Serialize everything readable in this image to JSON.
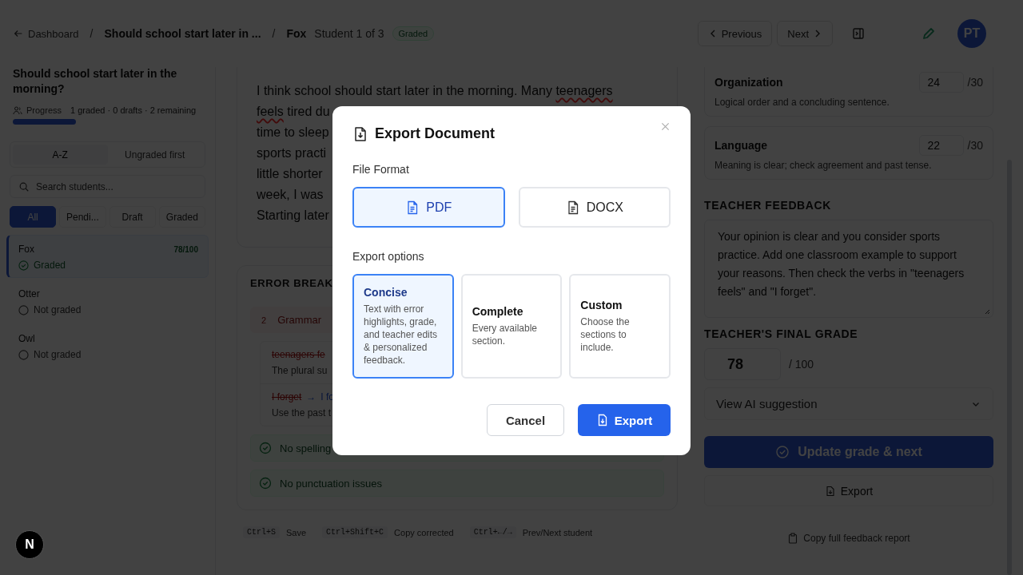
{
  "header": {
    "back_link": "Dashboard",
    "assignment_title": "Should school start later in ...",
    "student_name": "Fox",
    "student_position": "Student 1 of 3",
    "status_badge": "Graded",
    "separators": [
      "/",
      "/"
    ],
    "previous_button": "Previous",
    "next_button": "Next",
    "avatar_initials": "PT"
  },
  "sidebar": {
    "title": "Should school start later in the morning?",
    "progress_label": "Progress",
    "progress_summary": "1 graded · 0 drafts · 2 remaining",
    "progress": {
      "level": 0.33
    },
    "sort_options": [
      {
        "label": "A-Z",
        "selected": true
      },
      {
        "label": "Ungraded first",
        "selected": false
      }
    ],
    "search": {
      "placeholder": "Search students..."
    },
    "filters": [
      {
        "label": "All",
        "selected": true
      },
      {
        "label": "Pendi...",
        "selected": false
      },
      {
        "label": "Draft",
        "selected": false
      },
      {
        "label": "Graded",
        "selected": false
      }
    ],
    "students": [
      {
        "name": "Fox",
        "score": "78/100",
        "status": "Graded",
        "graded": true,
        "selected": true
      },
      {
        "name": "Otter",
        "status": "Not graded",
        "graded": false,
        "selected": false
      },
      {
        "name": "Owl",
        "status": "Not graded",
        "graded": false,
        "selected": false
      }
    ]
  },
  "essay": {
    "lines": [
      [
        {
          "text": "I think school should start later in the morning. Many ",
          "error": false
        },
        {
          "text": "teenagers",
          "error": true
        }
      ],
      [
        {
          "text": "feels",
          "error": true
        },
        {
          "text": " tired du",
          "error": false
        }
      ],
      [
        {
          "text": "time to sleep",
          "error": false
        }
      ],
      [
        {
          "text": "sports practi",
          "error": false
        }
      ],
      [
        {
          "text": "little shorter",
          "error": false
        }
      ],
      [
        {
          "text": "week, I was",
          "error": false
        }
      ],
      [
        {
          "text": "Starting later",
          "error": false
        }
      ]
    ]
  },
  "error_breakdown": {
    "title": "ERROR BREAK",
    "grammar": {
      "count": "2",
      "label": "Grammar"
    },
    "errors": [
      {
        "original": "teenagers fe",
        "note": "The plural su"
      },
      {
        "original": "I forget",
        "arrow": "→",
        "correction": "I fo",
        "note": "Use the past t"
      }
    ],
    "checks": [
      {
        "text": "No spelling"
      },
      {
        "text": "No punctuation issues"
      }
    ]
  },
  "shortcuts": [
    {
      "keys": "Ctrl+S",
      "action": "Save"
    },
    {
      "keys": "Ctrl+Shift+C",
      "action": "Copy corrected"
    },
    {
      "keys": "Ctrl+←/→",
      "action": "Prev/Next student"
    }
  ],
  "criteria": [
    {
      "name": "Organization",
      "score": "24",
      "max": "/30",
      "description": "Logical order and a concluding sentence."
    },
    {
      "name": "Language",
      "score": "22",
      "max": "/30",
      "description": "Meaning is clear; check agreement and past tense."
    }
  ],
  "feedback": {
    "title": "TEACHER FEEDBACK",
    "text": "Your opinion is clear and you consider sports practice. Add one classroom example to support your reasons. Then check the verbs in \"teenagers feels\" and \"I forget\"."
  },
  "final_grade": {
    "title": "TEACHER'S FINAL GRADE",
    "value": "78",
    "max": "/ 100"
  },
  "ai_suggestion": {
    "label": "View AI suggestion",
    "expanded": false
  },
  "update_button": "Update grade & next",
  "export_button": "Export",
  "copy_link": "Copy full feedback report",
  "dev_badge": "N",
  "modal": {
    "title": "Export Document",
    "file_format_label": "File Format",
    "formats": [
      {
        "label": "PDF",
        "selected": true
      },
      {
        "label": "DOCX",
        "selected": false
      }
    ],
    "options_label": "Export options",
    "options": [
      {
        "title": "Concise",
        "description": "Text with error highlights, grade, and teacher edits & personalized feedback.",
        "selected": true
      },
      {
        "title": "Complete",
        "description": "Every available section.",
        "selected": false
      },
      {
        "title": "Custom",
        "description": "Choose the sections to include.",
        "selected": false
      }
    ],
    "cancel_button": "Cancel",
    "export_button": "Export"
  }
}
